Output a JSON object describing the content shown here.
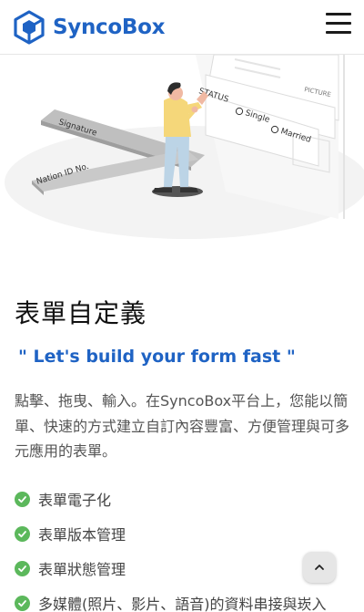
{
  "header": {
    "brand": "SyncoBox",
    "menu_icon": "hamburger-menu-icon"
  },
  "hero": {
    "labels": {
      "status": "STATUS",
      "single": "Single",
      "married": "Married",
      "picture": "PICTURE",
      "signature": "Signature",
      "nation_id": "Nation ID No."
    }
  },
  "content": {
    "title": "表單自定義",
    "quote": "\" Let's build your form fast \"",
    "description": "點擊、拖曳、輸入。在SyncoBox平台上，您能以簡單、快速的方式建立自訂內容豐富、方便管理與可多元應用的表單。",
    "features": [
      "表單電子化",
      "表單版本管理",
      "表單狀態管理",
      "多媒體(照片、影片、語音)的資料串接與崁入"
    ]
  },
  "scroll_top": {
    "icon": "chevron-up-icon"
  },
  "colors": {
    "brand": "#1f63c4",
    "check": "#5cb85c",
    "text": "#555555"
  }
}
